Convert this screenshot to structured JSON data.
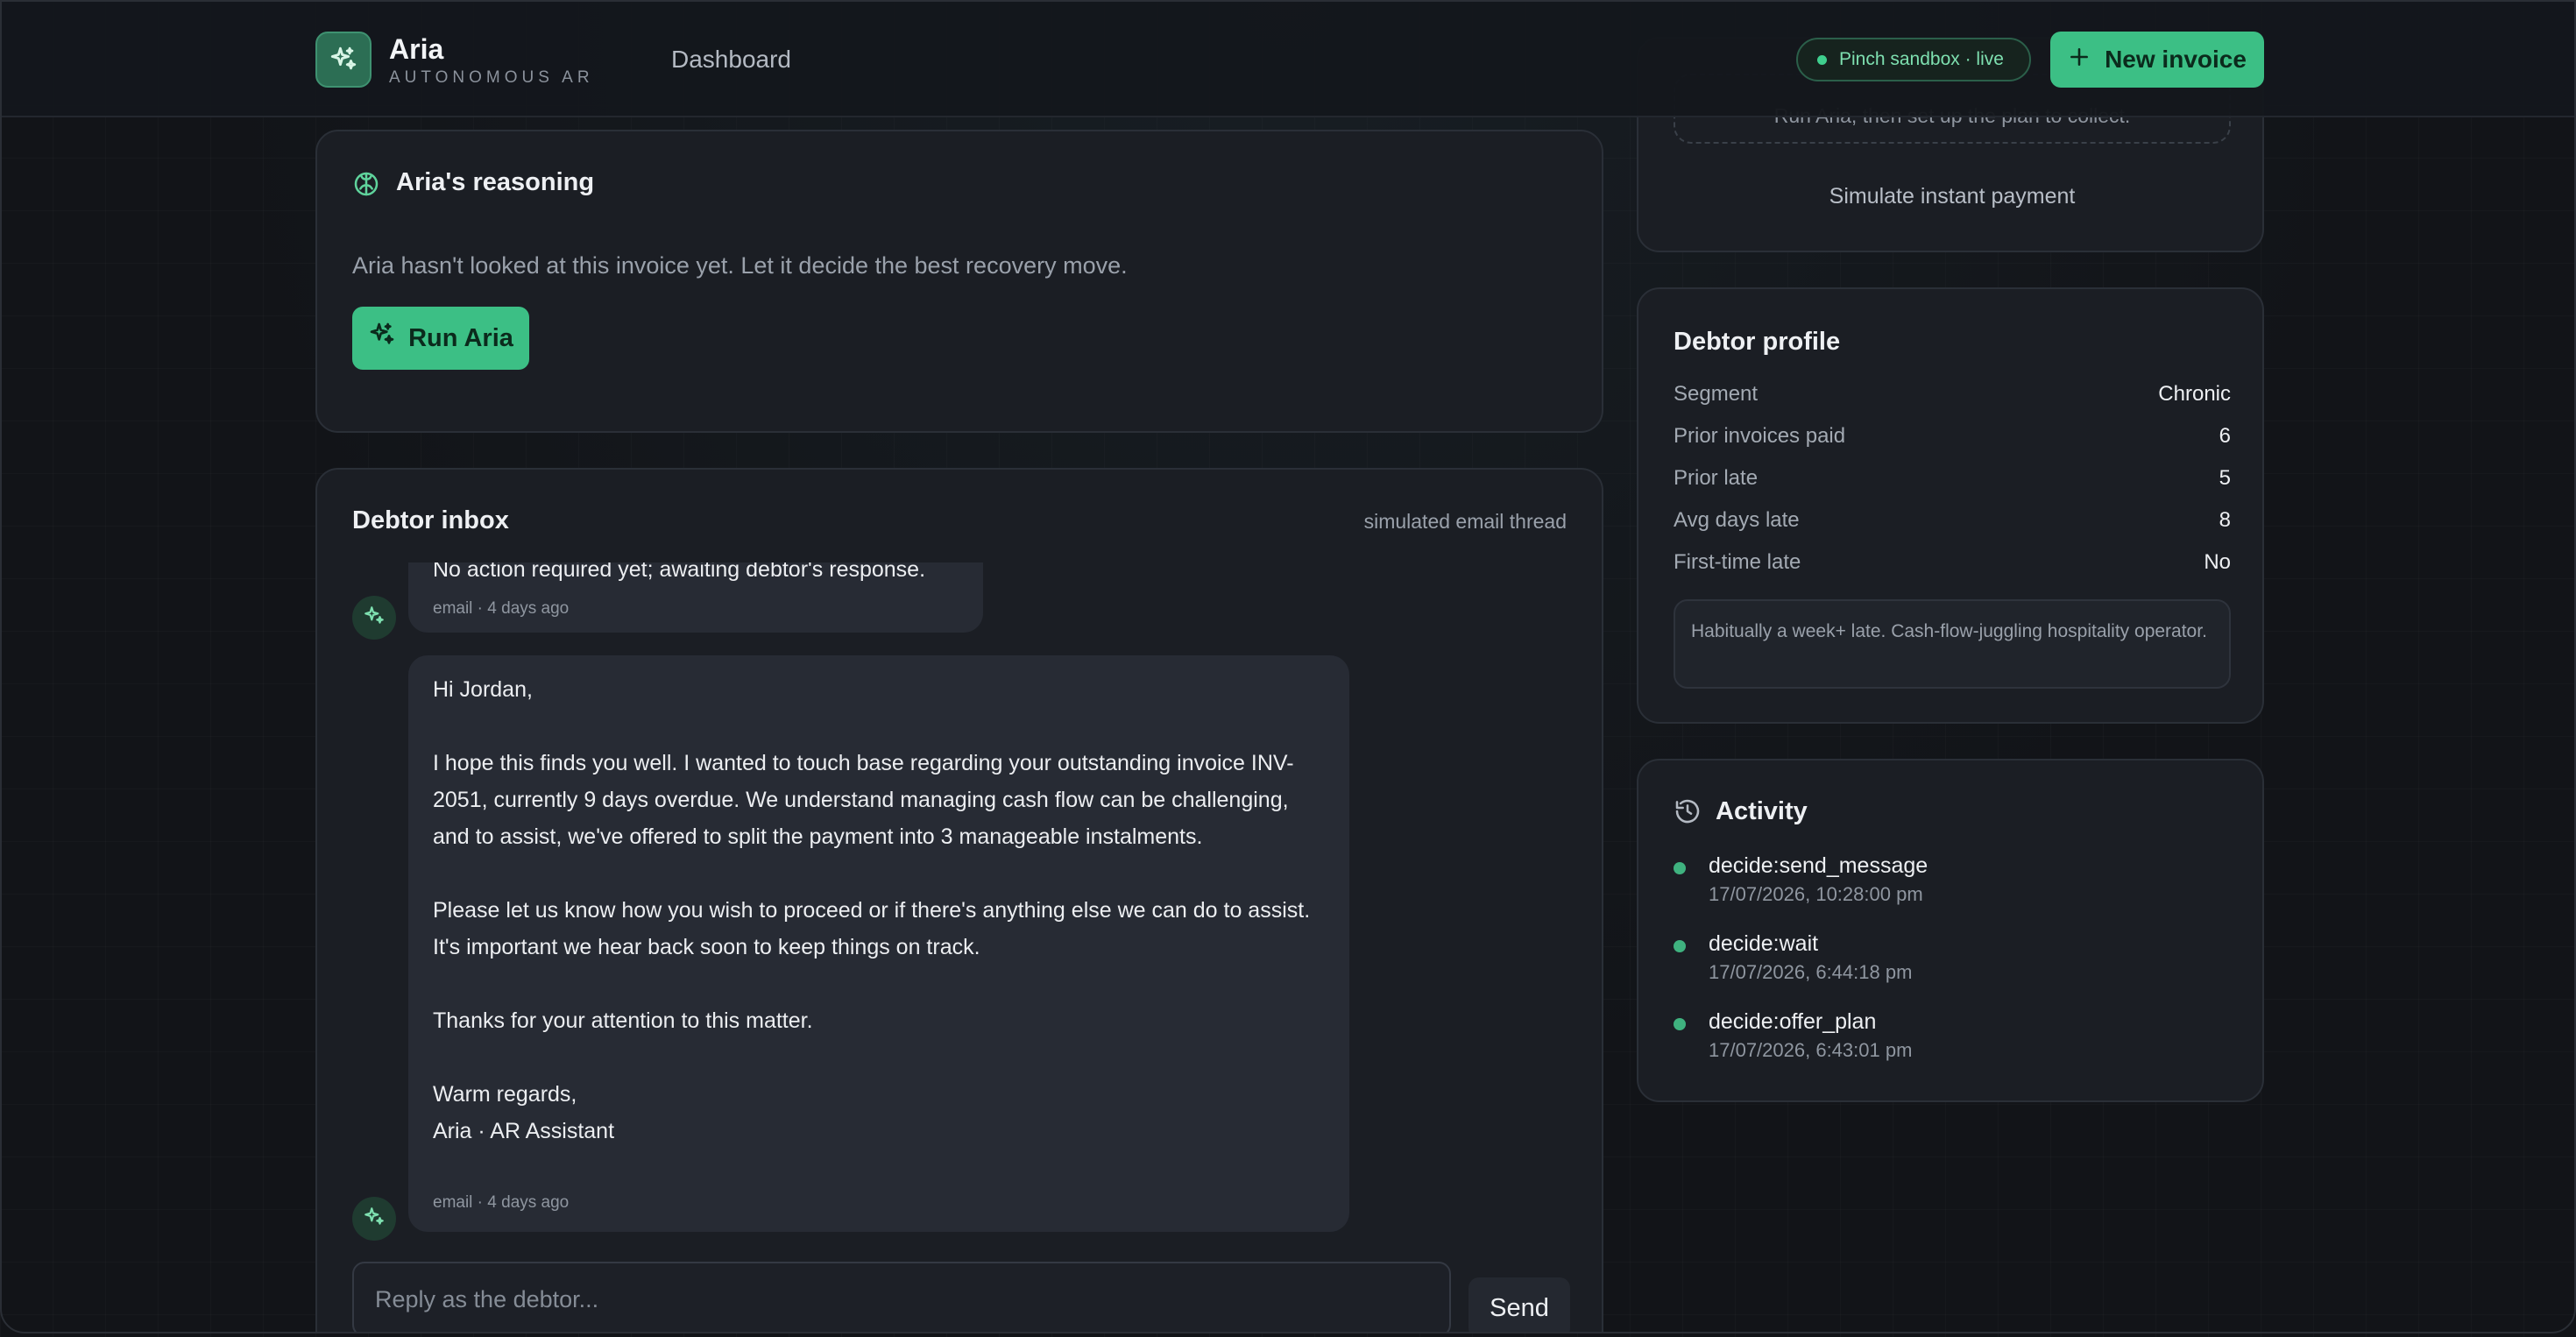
{
  "header": {
    "brand_name": "Aria",
    "brand_sub": "AUTONOMOUS AR",
    "nav_dashboard": "Dashboard",
    "sandbox_badge": "Pinch sandbox · live",
    "new_invoice_label": "New invoice"
  },
  "reasoning": {
    "title": "Aria's reasoning",
    "description": "Aria hasn't looked at this invoice yet. Let it decide the best recovery move.",
    "run_label": "Run Aria"
  },
  "plan": {
    "hint": "Run Aria, then set up the plan to collect.",
    "simulate_label": "Simulate instant payment"
  },
  "inbox": {
    "title": "Debtor inbox",
    "subtitle": "simulated email thread",
    "messages": [
      {
        "body": "No action required yet; awaiting debtor's response.",
        "meta": "email · 4 days ago"
      },
      {
        "greeting": "Hi Jordan,",
        "para1": "I hope this finds you well. I wanted to touch base regarding your outstanding invoice INV-2051, currently 9 days overdue. We understand managing cash flow can be challenging, and to assist, we've offered to split the payment into 3 manageable instalments.",
        "para2": "Please let us know how you wish to proceed or if there's anything else we can do to assist. It's important we hear back soon to keep things on track.",
        "para3": "Thanks for your attention to this matter.",
        "signoff": "Warm regards,",
        "signature": "Aria · AR Assistant",
        "meta": "email · 4 days ago"
      }
    ],
    "reply_placeholder": "Reply as the debtor...",
    "send_label": "Send"
  },
  "profile": {
    "title": "Debtor profile",
    "rows": [
      {
        "label": "Segment",
        "value": "Chronic"
      },
      {
        "label": "Prior invoices paid",
        "value": "6"
      },
      {
        "label": "Prior late",
        "value": "5"
      },
      {
        "label": "Avg days late",
        "value": "8"
      },
      {
        "label": "First-time late",
        "value": "No"
      }
    ],
    "note": "Habitually a week+ late. Cash-flow-juggling hospitality operator."
  },
  "activity": {
    "title": "Activity",
    "items": [
      {
        "name": "decide:send_message",
        "time": "17/07/2026, 10:28:00 pm"
      },
      {
        "name": "decide:wait",
        "time": "17/07/2026, 6:44:18 pm"
      },
      {
        "name": "decide:offer_plan",
        "time": "17/07/2026, 6:43:01 pm"
      }
    ]
  },
  "colors": {
    "accent": "#3cbf85",
    "background": "#121418",
    "card": "#1b1e24",
    "status_dot": "#3fcf8e"
  },
  "icons": {
    "logo": "sparkles-icon",
    "new_invoice": "plus-icon",
    "reasoning": "brain-icon",
    "run": "sparkles-icon",
    "activity": "history-icon"
  }
}
